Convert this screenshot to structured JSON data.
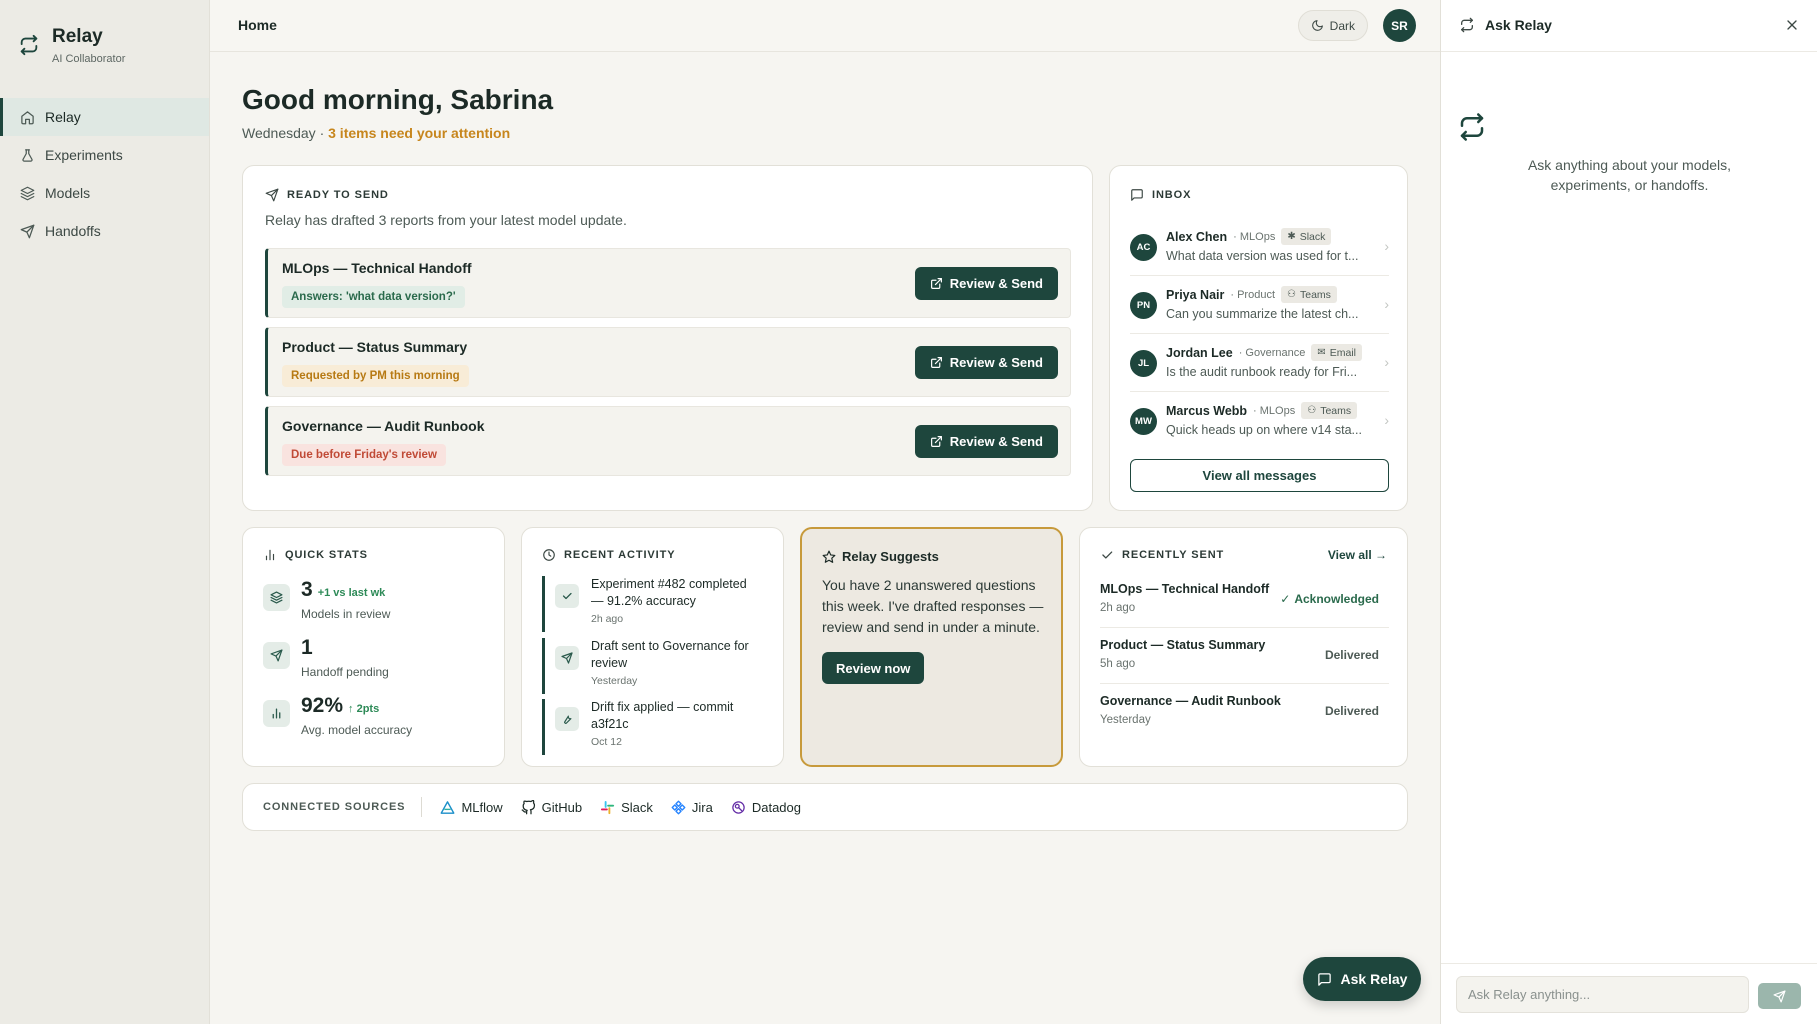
{
  "brand": {
    "name": "Relay",
    "subtitle": "AI Collaborator"
  },
  "nav": [
    {
      "label": "Relay",
      "icon": "home-icon",
      "active": true
    },
    {
      "label": "Experiments",
      "icon": "flask-icon"
    },
    {
      "label": "Models",
      "icon": "layers-icon"
    },
    {
      "label": "Handoffs",
      "icon": "send-icon"
    }
  ],
  "topbar": {
    "breadcrumb": "Home",
    "theme_toggle": "Dark",
    "avatar_initials": "SR"
  },
  "header": {
    "greeting": "Good morning, Sabrina",
    "day": "Wednesday · ",
    "attention": "3 items need your attention"
  },
  "ready_to_send": {
    "heading": "READY TO SEND",
    "description": "Relay has drafted 3 reports from your latest model update.",
    "reports": [
      {
        "title": "MLOps — Technical Handoff",
        "tag": "Answers: 'what data version?'",
        "tag_tone": "green",
        "action": "Review & Send"
      },
      {
        "title": "Product — Status Summary",
        "tag": "Requested by PM this morning",
        "tag_tone": "amber",
        "action": "Review & Send"
      },
      {
        "title": "Governance — Audit Runbook",
        "tag": "Due before Friday's review",
        "tag_tone": "red",
        "action": "Review & Send"
      }
    ]
  },
  "inbox": {
    "heading": "INBOX",
    "messages": [
      {
        "initials": "AC",
        "name": "Alex Chen",
        "team": "· MLOps",
        "channel": "Slack",
        "preview": "What data version was used for t..."
      },
      {
        "initials": "PN",
        "name": "Priya Nair",
        "team": "· Product",
        "channel": "Teams",
        "preview": "Can you summarize the latest ch..."
      },
      {
        "initials": "JL",
        "name": "Jordan Lee",
        "team": "· Governance",
        "channel": "Email",
        "preview": "Is the audit runbook ready for Fri..."
      },
      {
        "initials": "MW",
        "name": "Marcus Webb",
        "team": "· MLOps",
        "channel": "Teams",
        "preview": "Quick heads up on where v14 sta..."
      }
    ],
    "view_all": "View all messages"
  },
  "quick_stats": {
    "heading": "QUICK STATS",
    "stats": [
      {
        "value": "3",
        "delta": "+1 vs last wk",
        "label": "Models in review"
      },
      {
        "value": "1",
        "delta": "",
        "label": "Handoff pending"
      },
      {
        "value": "92%",
        "delta": "↑ 2pts",
        "label": "Avg. model accuracy"
      }
    ]
  },
  "recent_activity": {
    "heading": "RECENT ACTIVITY",
    "items": [
      {
        "text": "Experiment #482 completed — 91.2% accuracy",
        "when": "2h ago"
      },
      {
        "text": "Draft sent to Governance for review",
        "when": "Yesterday"
      },
      {
        "text": "Drift fix applied — commit a3f21c",
        "when": "Oct 12"
      }
    ]
  },
  "suggests": {
    "heading": "Relay Suggests",
    "body": "You have 2 unanswered questions this week. I've drafted responses — review and send in under a minute.",
    "action": "Review now"
  },
  "recently_sent": {
    "heading": "RECENTLY SENT",
    "view_all": "View all →",
    "items": [
      {
        "title": "MLOps — Technical Handoff",
        "when": "2h ago",
        "status": "Acknowledged"
      },
      {
        "title": "Product — Status Summary",
        "when": "5h ago",
        "status": "Delivered"
      },
      {
        "title": "Governance — Audit Runbook",
        "when": "Yesterday",
        "status": "Delivered"
      }
    ]
  },
  "sources": {
    "heading": "CONNECTED SOURCES",
    "items": [
      "MLflow",
      "GitHub",
      "Slack",
      "Jira",
      "Datadog"
    ]
  },
  "fab": {
    "label": "Ask Relay"
  },
  "panel": {
    "title": "Ask Relay",
    "hint": "Ask anything about your models, experiments, or handoffs.",
    "placeholder": "Ask Relay anything..."
  },
  "colors": {
    "primary": "#1e463d",
    "accent": "#c7861d",
    "suggest_border": "#c79a3b"
  }
}
